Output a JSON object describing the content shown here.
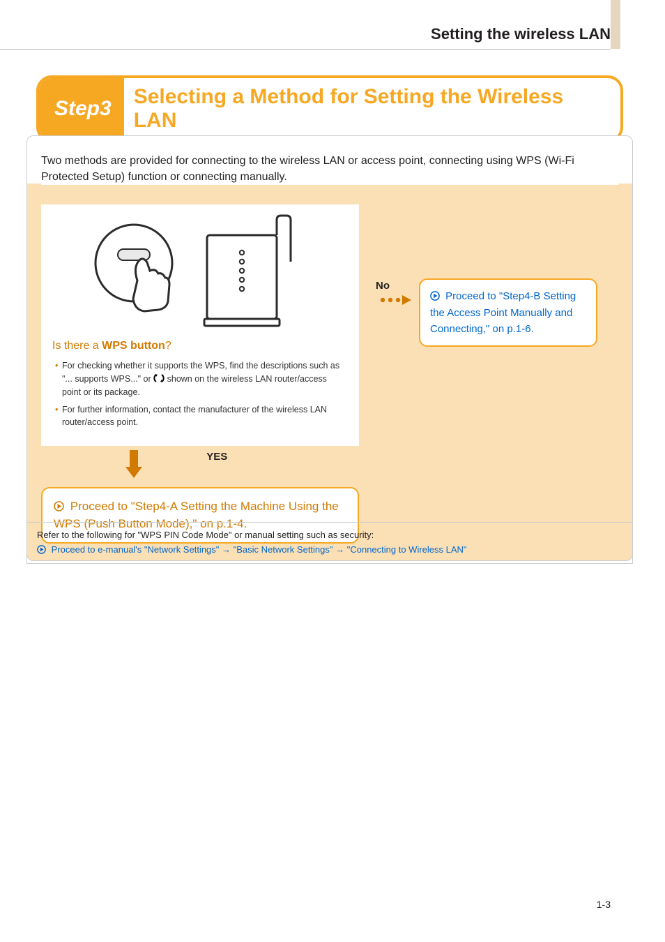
{
  "header": {
    "section_title": "Setting the wireless LAN"
  },
  "title": {
    "step_label": "Step3",
    "text": "Selecting a Method for Setting the Wireless LAN"
  },
  "intro": "Two methods are provided for connecting to the wireless LAN or access point, connecting using WPS (Wi-Fi Protected Setup) function or connecting manually.",
  "flow": {
    "question_prefix": "Is there a ",
    "question_bold": "WPS button",
    "question_suffix": "?",
    "tips": [
      "For checking whether it supports the WPS, find the descriptions such as \"... supports WPS...\" or  shown on the wireless LAN router/access point or its package.",
      "For further information, contact the manufacturer of the wireless LAN router/access point."
    ],
    "tip1_part1": "For checking whether it supports the WPS, find the descriptions such as \"... supports WPS...\" or ",
    "tip1_part2": " shown on the wireless LAN router/access point or its package.",
    "yes_label": "YES",
    "yes_proceed": "Proceed to \"Step4-A Setting the Machine Using the WPS (Push Button Mode),\" on p.1-4.",
    "no_label": "No",
    "no_proceed": "Proceed to \"Step4-B Setting the Access Point Manually and Connecting,\" on p.1-6."
  },
  "footnote": {
    "lead": "Refer to the following for \"WPS PIN Code Mode\" or manual setting such as security:",
    "link": "Proceed to e-manual's \"Network Settings\" → \"Basic Network Settings\" → \"Connecting to Wireless LAN\""
  },
  "page_number": "1-3"
}
